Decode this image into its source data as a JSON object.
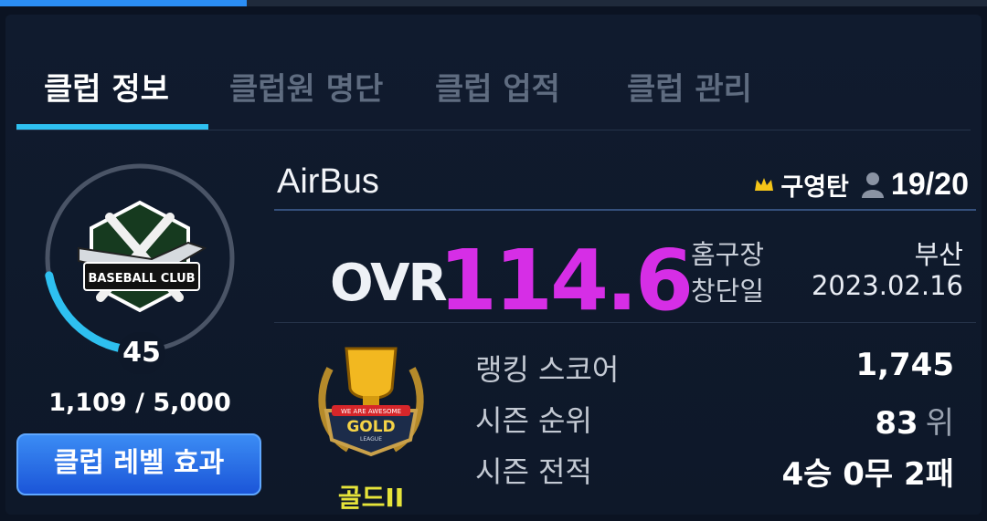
{
  "tabs": [
    {
      "label": "클럽 정보",
      "active": true
    },
    {
      "label": "클럽원 명단",
      "active": false
    },
    {
      "label": "클럽 업적",
      "active": false
    },
    {
      "label": "클럽 관리",
      "active": false
    }
  ],
  "club": {
    "name": "AirBus",
    "emblem_text": "BASEBALL CLUB",
    "level": "45",
    "level_progress_fraction": 0.22,
    "exp_text": "1,109 / 5,000",
    "level_button": "클럽 레벨 효과",
    "leader_name": "구영탄",
    "members": "19/20",
    "ovr_label": "OVR",
    "ovr_value": "114.6"
  },
  "info": [
    {
      "label": "홈구장",
      "value": "부산"
    },
    {
      "label": "창단일",
      "value": "2023.02.16"
    }
  ],
  "league": {
    "name": "골드II",
    "badge_text": "GOLD",
    "badge_ribbon": "WE ARE AWESOME",
    "badge_sub": "LEAGUE"
  },
  "stats": [
    {
      "label": "랭킹 스코어",
      "value": "1,745",
      "unit": ""
    },
    {
      "label": "시즌 순위",
      "value": "83",
      "unit": "위"
    },
    {
      "label": "시즌 전적",
      "value": "4승 0무 2패",
      "unit": ""
    }
  ],
  "colors": {
    "accent": "#2ec0f0",
    "ovr": "#d62ee6",
    "league": "#e6e43a",
    "button": "#2a6fe6",
    "crown": "#f5c518"
  },
  "icons": {
    "leader": "crown-icon",
    "members": "person-icon"
  }
}
